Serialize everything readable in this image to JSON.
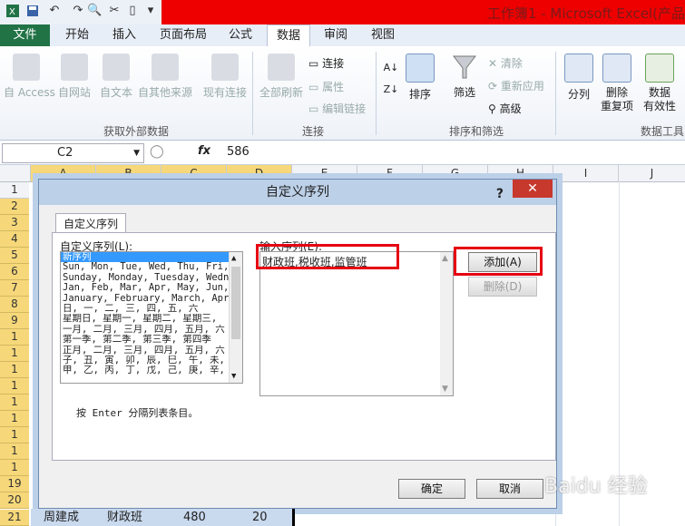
{
  "window": {
    "title": "工作簿1 - Microsoft Excel(产品"
  },
  "tabs": [
    "文件",
    "开始",
    "插入",
    "页面布局",
    "公式",
    "数据",
    "审阅",
    "视图"
  ],
  "ribbon": {
    "get_external": [
      "自 Access",
      "自网站",
      "自文本",
      "自其他来源",
      "现有连接"
    ],
    "refresh_all": "全部刷新",
    "connections": [
      "连接",
      "属性",
      "编辑链接"
    ],
    "sort": "排序",
    "filter": "筛选",
    "filter_side": [
      "清除",
      "重新应用",
      "高级"
    ],
    "split": "分列",
    "remove_dup": [
      "删除",
      "重复项"
    ],
    "validity": [
      "数据",
      "有效性"
    ],
    "groups": [
      "获取外部数据",
      "连接",
      "排序和筛选",
      "数据工具"
    ]
  },
  "formula_bar": {
    "name_box": "C2",
    "fx": "fx",
    "value": "586"
  },
  "columns": [
    "A",
    "B",
    "C",
    "D",
    "E",
    "F",
    "G",
    "H",
    "I",
    "J"
  ],
  "rows": [
    "1",
    "2",
    "3",
    "4",
    "5",
    "6",
    "7",
    "8",
    "9",
    "1",
    "1",
    "1",
    "1",
    "1",
    "1",
    "1",
    "1",
    "1",
    "19",
    "20",
    "21"
  ],
  "dialog": {
    "title": "自定义序列",
    "help": "?",
    "tab": "自定义序列",
    "list_label": "自定义序列(L):",
    "list_items": [
      "新序列",
      "Sun, Mon, Tue, Wed, Thu, Fri, S",
      "Sunday, Monday, Tuesday, Wednes",
      "Jan, Feb, Mar, Apr, May, Jun, J",
      "January, February, March, April,",
      "日, 一, 二, 三, 四, 五, 六",
      "星期日, 星期一, 星期二, 星期三,",
      "一月, 二月, 三月, 四月, 五月, 六",
      "第一季, 第二季, 第三季, 第四季",
      "正月, 二月, 三月, 四月, 五月, 六",
      "子, 丑, 寅, 卯, 辰, 巳, 午, 未,",
      "甲, 乙, 丙, 丁, 戊, 己, 庚, 辛,"
    ],
    "entry_label": "输入序列(E):",
    "entry_value": "财政班,税收班,监管班",
    "add_button": "添加(A)",
    "delete_button": "删除(D)",
    "hint": "按 Enter 分隔列表条目。",
    "ok_button": "确定",
    "cancel_button": "取消"
  },
  "last_row": {
    "name": "周建成",
    "class": "财政班",
    "c": "480",
    "d": "20"
  },
  "watermark": "Baidu 经验",
  "colors": {
    "accent_red": "#e60012",
    "excel_green": "#217346",
    "selection": "#f6d87a"
  }
}
